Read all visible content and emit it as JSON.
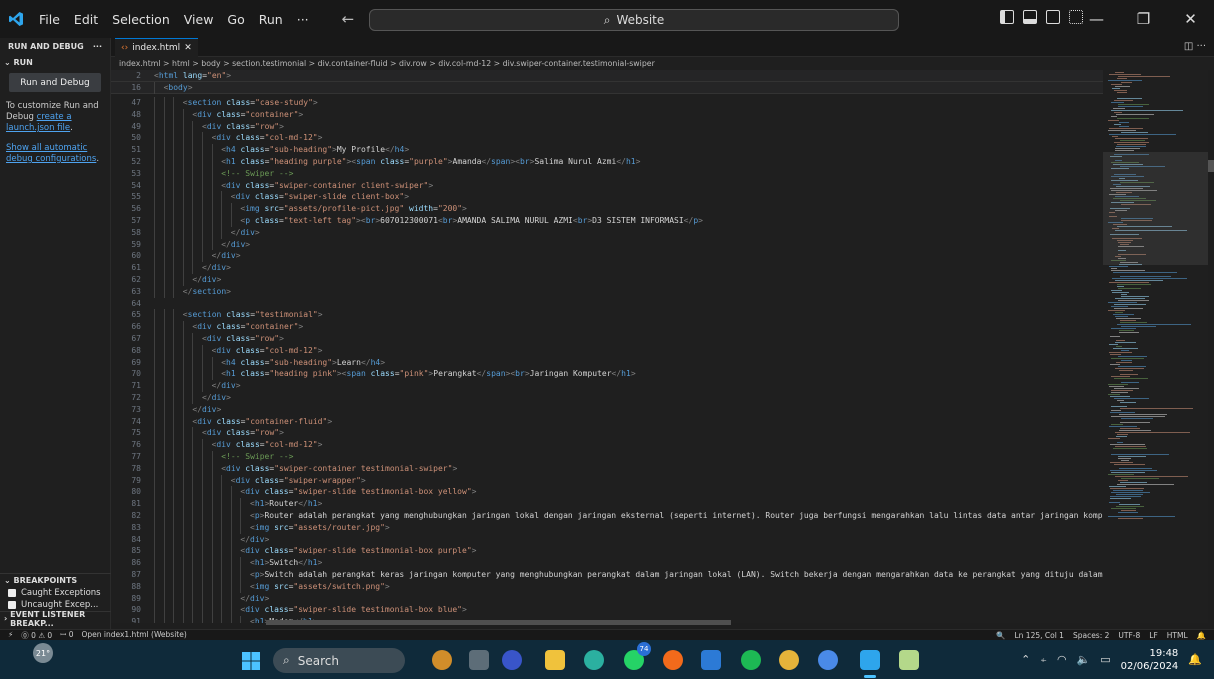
{
  "titlebar": {
    "menu": [
      "File",
      "Edit",
      "Selection",
      "View",
      "Go",
      "Run",
      "···"
    ],
    "search": "Website",
    "window_controls": [
      "minimize",
      "restore",
      "close"
    ]
  },
  "sidebar": {
    "header": "RUN AND DEBUG",
    "header_more": "···",
    "section": "RUN",
    "run_button": "Run and Debug",
    "help_prefix": "To customize Run and Debug ",
    "help_link": "create a launch.json file",
    "help_suffix": ".",
    "show_all_link": "Show all automatic debug configurations",
    "show_all_suffix": ".",
    "breakpoints_header": "BREAKPOINTS",
    "breakpoints": [
      "Caught Exceptions",
      "Uncaught Excep..."
    ],
    "event_listener_header": "EVENT LISTENER BREAKP..."
  },
  "editor": {
    "tab": "index.html",
    "breadcrumbs": "index.html > html > body > section.testimonial > div.container-fluid > div.row > div.col-md-12 > div.swiper-container.testimonial-swiper",
    "sticky_lines": [
      {
        "n": "2",
        "text": "<html lang=\"en\">"
      },
      {
        "n": "16",
        "text": "<body>"
      }
    ],
    "lines": [
      {
        "n": "47",
        "indent": 3,
        "text": "<section class=\"case-study\">"
      },
      {
        "n": "48",
        "indent": 4,
        "text": "<div class=\"container\">"
      },
      {
        "n": "49",
        "indent": 5,
        "text": "<div class=\"row\">"
      },
      {
        "n": "50",
        "indent": 6,
        "text": "<div class=\"col-md-12\">"
      },
      {
        "n": "51",
        "indent": 7,
        "text": "<h4 class=\"sub-heading\">My Profile</h4>"
      },
      {
        "n": "52",
        "indent": 7,
        "text": "<h1 class=\"heading purple\"><span class=\"purple\">Amanda</span><br>Salima Nurul Azmi</h1>"
      },
      {
        "n": "53",
        "indent": 7,
        "text": "<!-- Swiper -->"
      },
      {
        "n": "54",
        "indent": 7,
        "text": "<div class=\"swiper-container client-swiper\">"
      },
      {
        "n": "55",
        "indent": 8,
        "text": "<div class=\"swiper-slide client-box\">"
      },
      {
        "n": "56",
        "indent": 9,
        "text": "<img src=\"assets/profile-pict.jpg\" width=\"200\">"
      },
      {
        "n": "57",
        "indent": 9,
        "text": "<p class=\"text-left tag\"><br>607012300071<br>AMANDA SALIMA NURUL AZMI<br>D3 SISTEM INFORMASI</p>"
      },
      {
        "n": "58",
        "indent": 8,
        "text": "</div>"
      },
      {
        "n": "59",
        "indent": 7,
        "text": "</div>"
      },
      {
        "n": "60",
        "indent": 6,
        "text": "</div>"
      },
      {
        "n": "61",
        "indent": 5,
        "text": "</div>"
      },
      {
        "n": "62",
        "indent": 4,
        "text": "</div>"
      },
      {
        "n": "63",
        "indent": 3,
        "text": "</section>"
      },
      {
        "n": "64",
        "indent": 0,
        "text": ""
      },
      {
        "n": "65",
        "indent": 3,
        "text": "<section class=\"testimonial\">"
      },
      {
        "n": "66",
        "indent": 4,
        "text": "<div class=\"container\">"
      },
      {
        "n": "67",
        "indent": 5,
        "text": "<div class=\"row\">"
      },
      {
        "n": "68",
        "indent": 6,
        "text": "<div class=\"col-md-12\">"
      },
      {
        "n": "69",
        "indent": 7,
        "text": "<h4 class=\"sub-heading\">Learn</h4>"
      },
      {
        "n": "70",
        "indent": 7,
        "text": "<h1 class=\"heading pink\"><span class=\"pink\">Perangkat</span><br>Jaringan Komputer</h1>"
      },
      {
        "n": "71",
        "indent": 6,
        "text": "</div>"
      },
      {
        "n": "72",
        "indent": 5,
        "text": "</div>"
      },
      {
        "n": "73",
        "indent": 4,
        "text": "</div>"
      },
      {
        "n": "74",
        "indent": 4,
        "text": "<div class=\"container-fluid\">"
      },
      {
        "n": "75",
        "indent": 5,
        "text": "<div class=\"row\">"
      },
      {
        "n": "76",
        "indent": 6,
        "text": "<div class=\"col-md-12\">"
      },
      {
        "n": "77",
        "indent": 7,
        "text": "<!-- Swiper -->"
      },
      {
        "n": "78",
        "indent": 7,
        "text": "<div class=\"swiper-container testimonial-swiper\">"
      },
      {
        "n": "79",
        "indent": 8,
        "text": "<div class=\"swiper-wrapper\">"
      },
      {
        "n": "80",
        "indent": 9,
        "text": "<div class=\"swiper-slide testimonial-box yellow\">"
      },
      {
        "n": "81",
        "indent": 10,
        "text": "<h1>Router</h1>"
      },
      {
        "n": "82",
        "indent": 10,
        "text": "<p>Router adalah perangkat yang menghubungkan jaringan lokal dengan jaringan eksternal (seperti internet). Router juga berfungsi mengarahkan lalu lintas data antar jaringan komputer"
      },
      {
        "n": "83",
        "indent": 10,
        "text": "<img src=\"assets/router.jpg\">"
      },
      {
        "n": "84",
        "indent": 9,
        "text": "</div>"
      },
      {
        "n": "85",
        "indent": 9,
        "text": "<div class=\"swiper-slide testimonial-box purple\">"
      },
      {
        "n": "86",
        "indent": 10,
        "text": "<h1>Switch</h1>"
      },
      {
        "n": "87",
        "indent": 10,
        "text": "<p>Switch adalah perangkat keras jaringan komputer yang menghubungkan perangkat dalam jaringan lokal (LAN). Switch bekerja dengan mengarahkan data ke perangkat yang dituju dalam jar"
      },
      {
        "n": "88",
        "indent": 10,
        "text": "<img src=\"assets/switch.png\">"
      },
      {
        "n": "89",
        "indent": 9,
        "text": "</div>"
      },
      {
        "n": "90",
        "indent": 9,
        "text": "<div class=\"swiper-slide testimonial-box blue\">"
      },
      {
        "n": "91",
        "indent": 10,
        "text": "<h1>Modem</h1>"
      }
    ]
  },
  "statusbar": {
    "left": [
      "⓪ 0 ⚠ 0",
      "ꟷ 0",
      "Open index1.html (Website)"
    ],
    "right": [
      "Ln 125, Col 1",
      "Spaces: 2",
      "UTF-8",
      "LF",
      "HTML"
    ]
  },
  "taskbar": {
    "weather_temp": "21°",
    "search": "Search",
    "badge": "74",
    "time": "19:48",
    "date": "02/06/2024"
  },
  "colors": {
    "accent": "#0078d4",
    "editor_bg": "#1f1f1f",
    "taskbar_bg": "#0f2a3a"
  }
}
